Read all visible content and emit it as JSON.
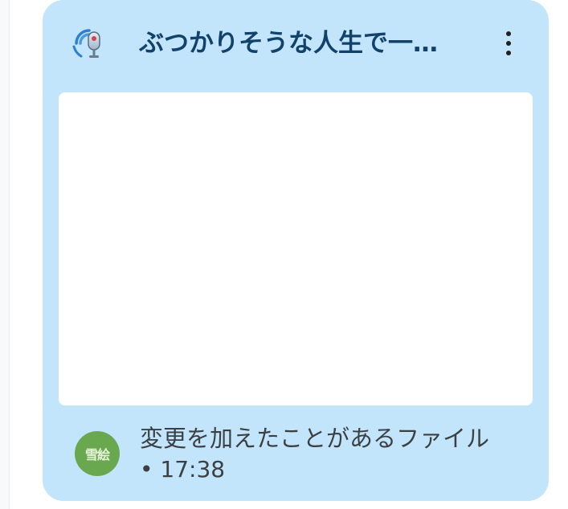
{
  "card": {
    "title": "ぶつかりそうな人生で一…",
    "app_icon": "podcast-microphone-icon",
    "menu_icon": "more-vert-icon",
    "avatar_text": "雪絵",
    "activity_text": "変更を加えたことがあるファイル",
    "time_text": "• 17:38",
    "colors": {
      "card_background": "#c2e5fc",
      "title": "#12426a",
      "avatar_background": "#6aa84f"
    }
  }
}
